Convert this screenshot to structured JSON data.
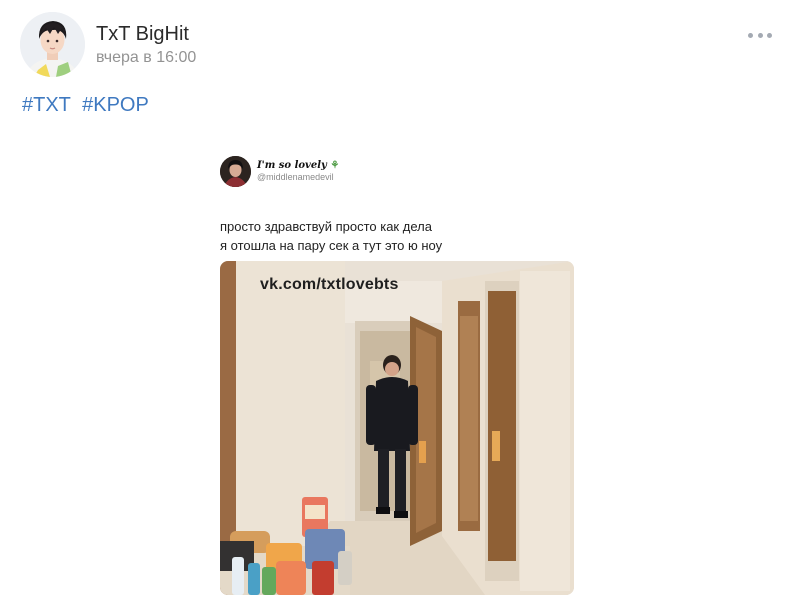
{
  "post": {
    "author": "TxT BigHit",
    "time": "вчера в 16:00",
    "hashtags": [
      "#TXT",
      "#KPOP"
    ]
  },
  "tweet": {
    "display_name": "I'm so lovely",
    "handle": "@middlenamedevil",
    "lines": [
      "просто здравствуй просто как дела",
      "я отошла на пару сек а тут это ю ноу"
    ],
    "photo_watermark": "vk.com/txtlovebts"
  },
  "icons": {
    "more": "more-horizontal-icon",
    "plant": "plant-emoji-icon"
  }
}
